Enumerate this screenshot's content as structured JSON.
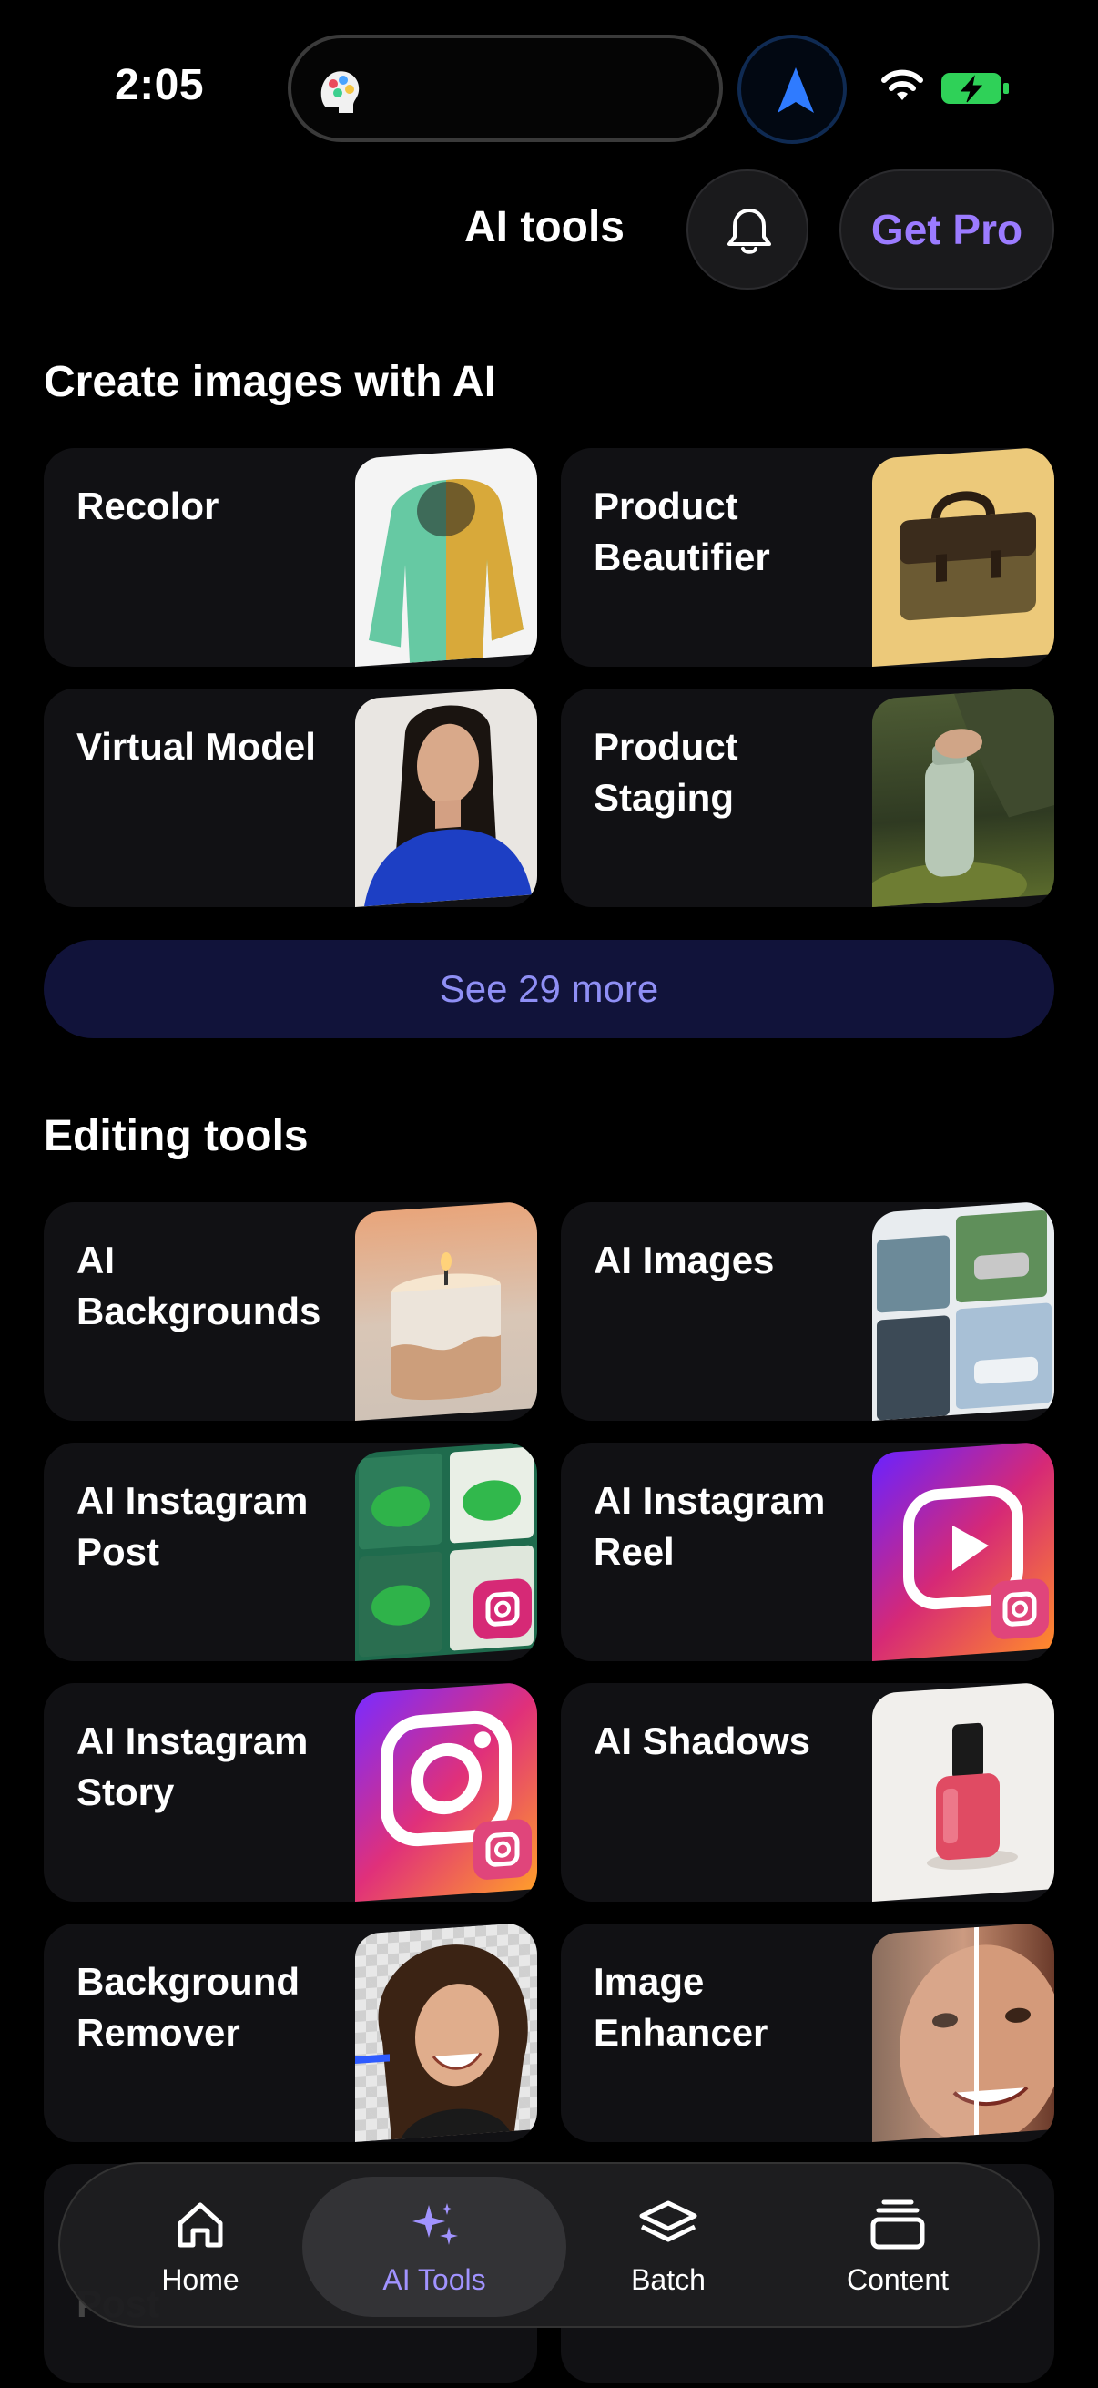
{
  "status_bar": {
    "time": "2:05"
  },
  "header": {
    "title": "AI tools",
    "get_pro_label": "Get Pro"
  },
  "create_section": {
    "title": "Create images with AI",
    "cards": [
      {
        "label": "Recolor"
      },
      {
        "label": "Product Beautifier"
      },
      {
        "label": "Virtual Model"
      },
      {
        "label": "Product Staging"
      }
    ],
    "see_more_label": "See 29 more"
  },
  "editing_section": {
    "title": "Editing tools",
    "cards": [
      {
        "label": "AI Backgrounds"
      },
      {
        "label": "AI Images"
      },
      {
        "label": "AI Instagram Post"
      },
      {
        "label": "AI Instagram Reel"
      },
      {
        "label": "AI Instagram Story"
      },
      {
        "label": "AI Shadows"
      },
      {
        "label": "Background Remover"
      },
      {
        "label": "Image Enhancer"
      }
    ],
    "peek_label": "Post"
  },
  "bottom_nav": {
    "items": [
      {
        "label": "Home",
        "icon": "home-icon"
      },
      {
        "label": "AI Tools",
        "icon": "sparkles-icon",
        "active": true
      },
      {
        "label": "Batch",
        "icon": "layers-icon"
      },
      {
        "label": "Content",
        "icon": "stack-icon"
      }
    ]
  },
  "colors": {
    "accent": "#9b7bff",
    "see_more_bg": "#11133a",
    "see_more_text": "#8f8ff5",
    "card_bg": "#111114"
  }
}
